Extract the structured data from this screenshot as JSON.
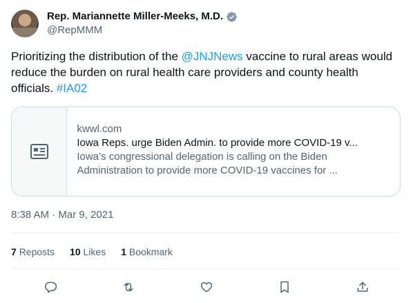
{
  "author": {
    "name": "Rep. Mariannette Miller-Meeks, M.D.",
    "handle": "@RepMMM"
  },
  "tweet": {
    "text_part1": "Prioritizing the distribution of the ",
    "mention": "@JNJNews",
    "text_part2": " vaccine to rural areas would reduce the burden on rural health care providers and county health officials. ",
    "hashtag": "#IA02"
  },
  "card": {
    "domain": "kwwl.com",
    "title": "Iowa Reps. urge Biden Admin. to provide more COVID-19 v...",
    "description": "Iowa’s congressional delegation is calling on the Biden Administration to provide more COVID-19 vaccines for ..."
  },
  "timestamp": "8:38 AM · Mar 9, 2021",
  "stats": {
    "reposts_count": "7",
    "reposts_label": "Reposts",
    "likes_count": "10",
    "likes_label": "Likes",
    "bookmarks_count": "1",
    "bookmarks_label": "Bookmark"
  },
  "icons": {
    "reply": "reply-icon",
    "repost": "repost-icon",
    "like": "like-icon",
    "bookmark": "bookmark-icon",
    "share": "share-icon",
    "verified": "verified-badge-icon",
    "article": "article-icon"
  },
  "colors": {
    "link": "#1d9bf0",
    "secondary_text": "#536471",
    "border": "#cfd9de"
  }
}
